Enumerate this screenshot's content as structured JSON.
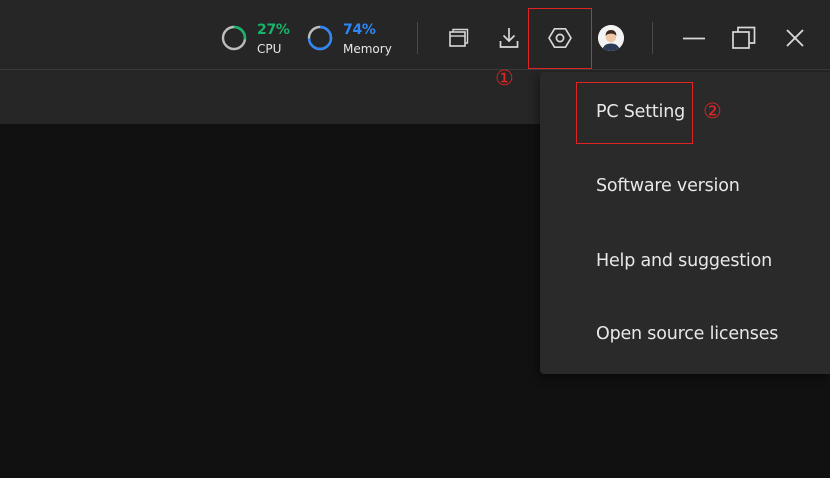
{
  "titlebar": {
    "cpu": {
      "percent": "27%",
      "label": "CPU",
      "color": "#16b46a",
      "fraction": 0.27
    },
    "memory": {
      "percent": "74%",
      "label": "Memory",
      "color": "#2f86f6",
      "fraction": 0.74
    },
    "icons": [
      "window-icon",
      "download-icon",
      "settings-icon",
      "avatar",
      "minimize-icon",
      "restore-icon",
      "close-icon"
    ]
  },
  "annotations": {
    "step1": "①",
    "step2": "②",
    "color": "#e02424"
  },
  "menu": {
    "items": [
      {
        "label": "PC Setting"
      },
      {
        "label": "Software version"
      },
      {
        "label": "Help and suggestion"
      },
      {
        "label": "Open source licenses"
      }
    ]
  }
}
